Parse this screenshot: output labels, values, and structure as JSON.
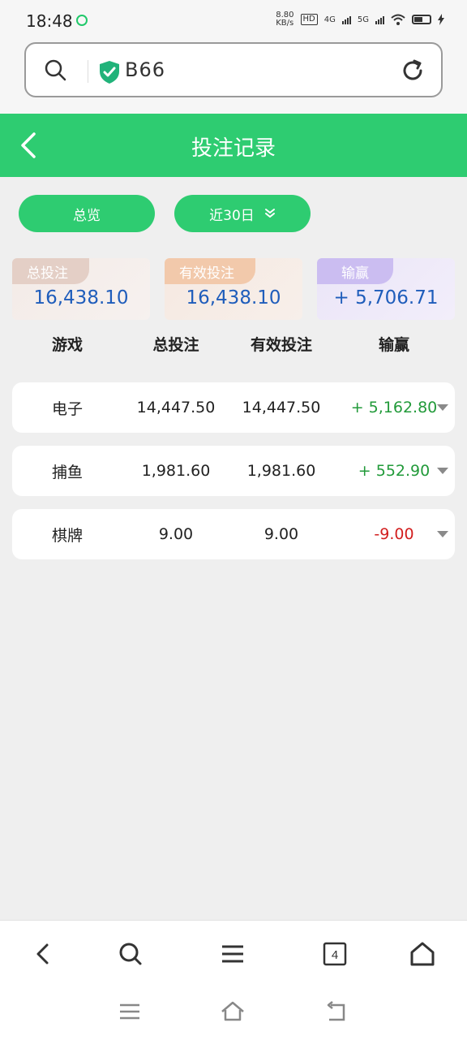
{
  "status": {
    "time": "18:48",
    "net_speed_value": "8.80",
    "net_speed_unit": "KB/s",
    "hd_badge": "HD",
    "sig1_label": "4G",
    "sig2_label": "5G"
  },
  "browser": {
    "url_text": "B66"
  },
  "header": {
    "title": "投注记录"
  },
  "filters": {
    "overview_label": "总览",
    "range_label": "近30日"
  },
  "summary": {
    "total": {
      "label": "总投注",
      "value": "16,438.10"
    },
    "valid": {
      "label": "有效投注",
      "value": "16,438.10"
    },
    "win": {
      "label": "输赢",
      "value": "+ 5,706.71"
    }
  },
  "table": {
    "headers": [
      "游戏",
      "总投注",
      "有效投注",
      "输赢"
    ],
    "rows": [
      {
        "game": "电子",
        "total": "14,447.50",
        "valid": "14,447.50",
        "win": "+ 5,162.80",
        "positive": true
      },
      {
        "game": "捕鱼",
        "total": "1,981.60",
        "valid": "1,981.60",
        "win": "+ 552.90",
        "positive": true
      },
      {
        "game": "棋牌",
        "total": "9.00",
        "valid": "9.00",
        "win": "-9.00",
        "positive": false
      }
    ]
  },
  "bottom_nav": {
    "tab_count": "4"
  },
  "colors": {
    "accent": "#2ecc71",
    "value_blue": "#1f5dbb",
    "win_positive": "#229a3a",
    "win_negative": "#d21e1e"
  }
}
